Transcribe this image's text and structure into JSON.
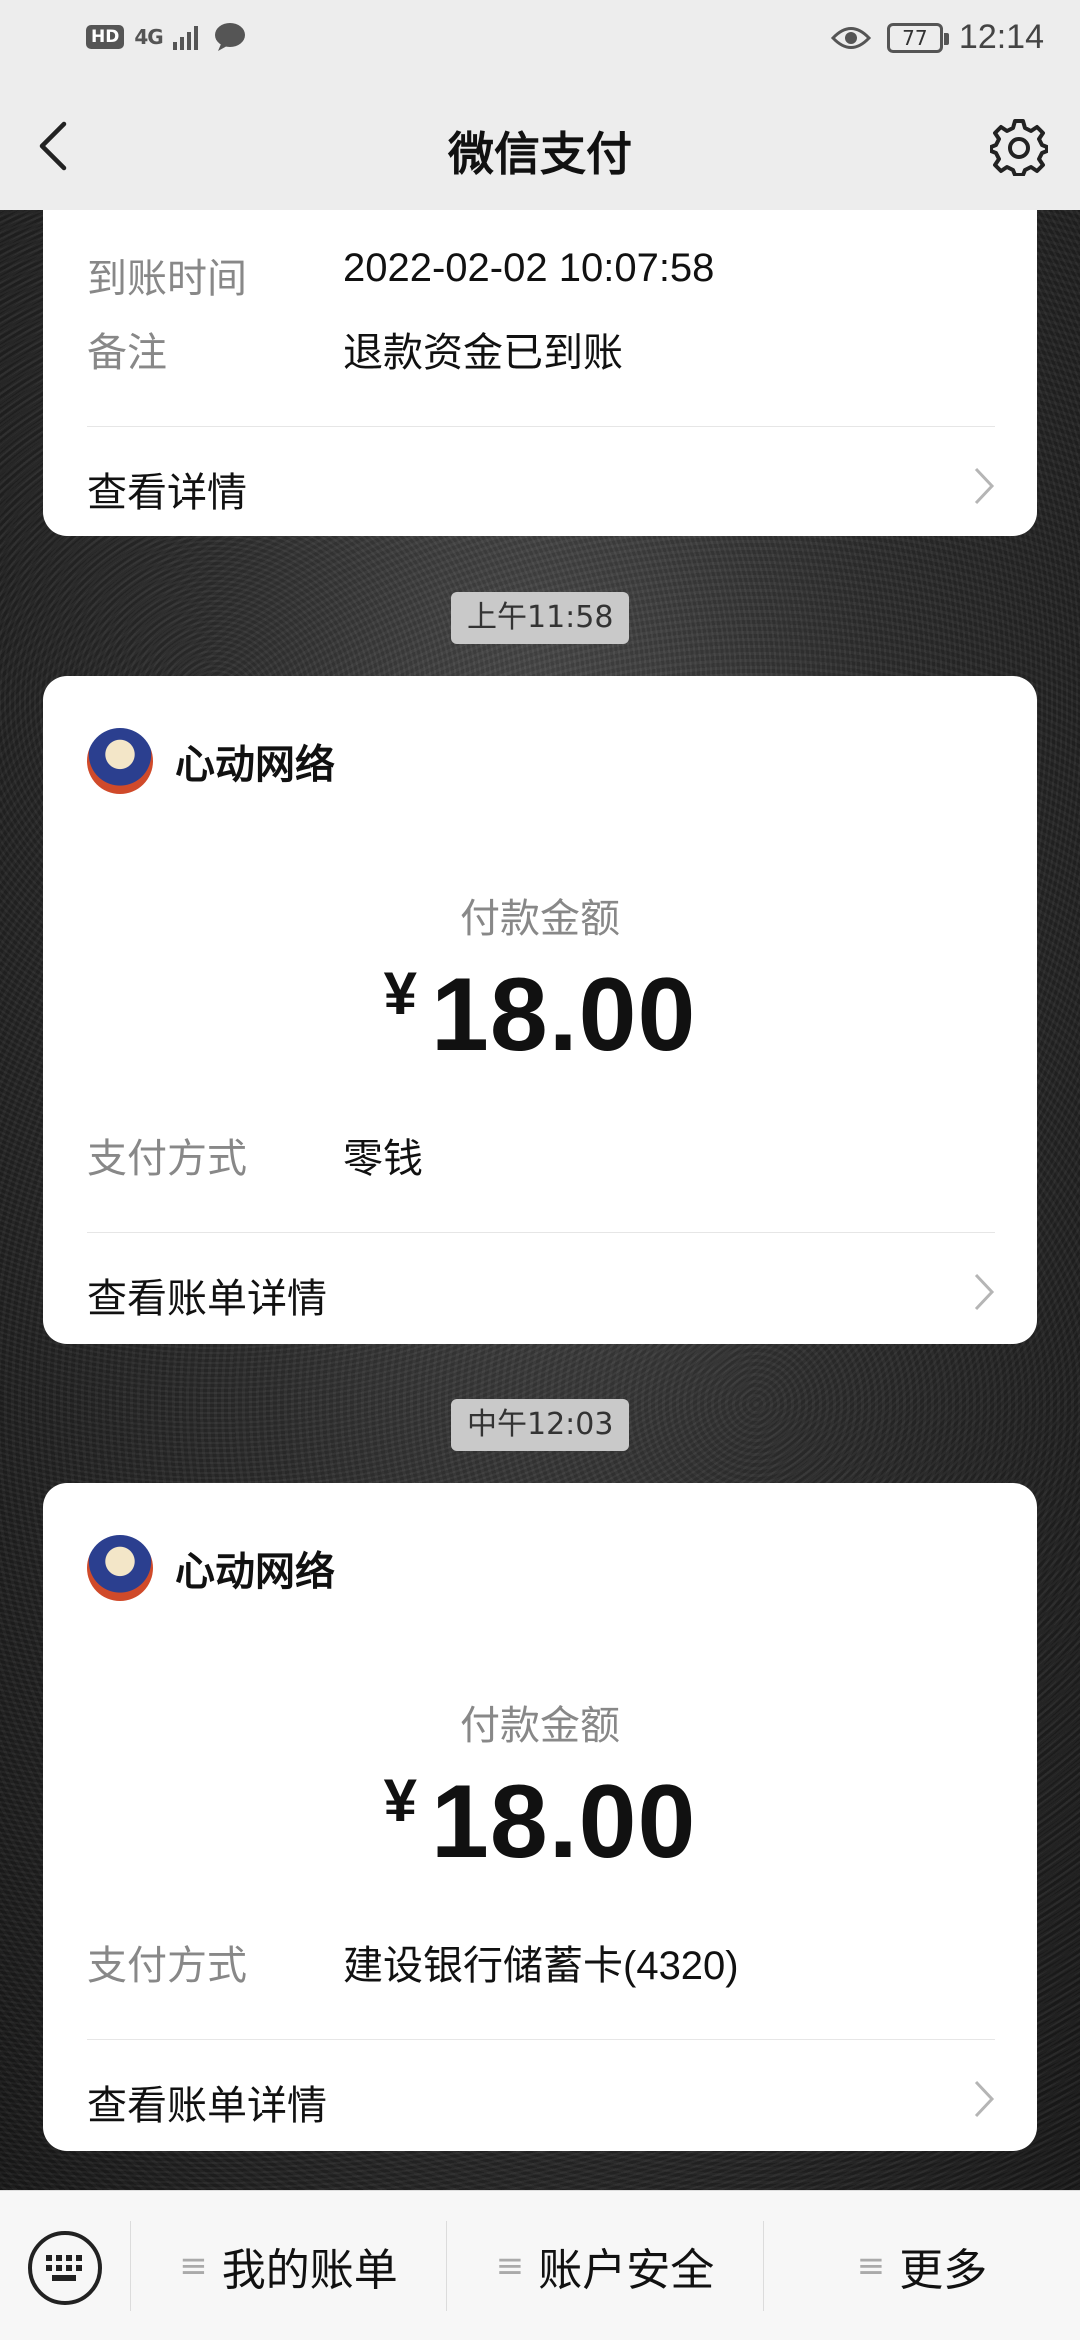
{
  "status_bar": {
    "hd": "HD",
    "network": "4G",
    "battery": "77",
    "time": "12:14"
  },
  "nav": {
    "title": "微信支付"
  },
  "card_top": {
    "cut_text": "",
    "arrival_time_label": "到账时间",
    "arrival_time_value": "2022-02-02 10:07:58",
    "remark_label": "备注",
    "remark_value": "退款资金已到账",
    "view_details": "查看详情"
  },
  "messages": [
    {
      "time": "上午11:58",
      "merchant": "心动网络",
      "amount_label": "付款金额",
      "currency": "¥",
      "amount": "18.00",
      "method_label": "支付方式",
      "method_value": "零钱",
      "view_bill": "查看账单详情"
    },
    {
      "time": "中午12:03",
      "merchant": "心动网络",
      "amount_label": "付款金额",
      "currency": "¥",
      "amount": "18.00",
      "method_label": "支付方式",
      "method_value": "建设银行储蓄卡(4320)",
      "view_bill": "查看账单详情"
    }
  ],
  "bottom_bar": {
    "tabs": [
      "我的账单",
      "账户安全",
      "更多"
    ],
    "menu_glyph": "≡"
  },
  "icons": {
    "back": "chevron-left-icon",
    "settings": "gear-icon",
    "keyboard": "keyboard-icon",
    "row_arrow": "chevron-right-icon"
  }
}
